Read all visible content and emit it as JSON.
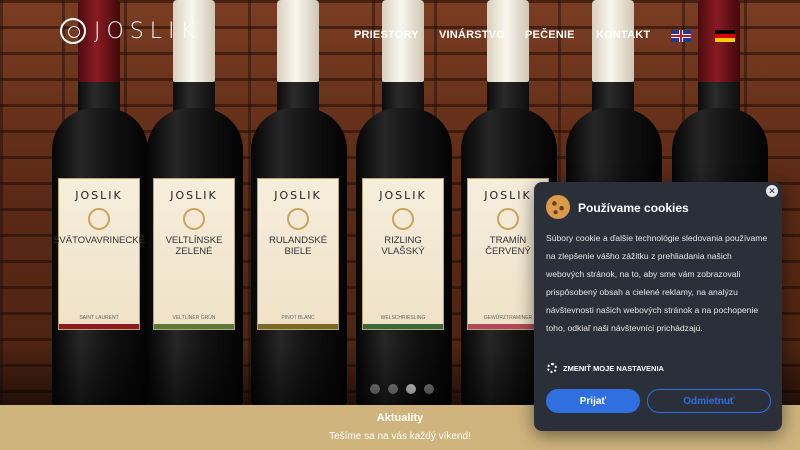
{
  "brand": {
    "name": "JOSLIK",
    "icon": "joslik-logo-icon"
  },
  "nav": {
    "items": [
      {
        "label": "PRIESTORY"
      },
      {
        "label": "VINÁRSTVO"
      },
      {
        "label": "PEČENIE"
      },
      {
        "label": "KONTAKT"
      }
    ],
    "languages": [
      {
        "name": "English",
        "icon": "uk-flag-icon"
      },
      {
        "name": "Deutsch",
        "icon": "de-flag-icon"
      }
    ]
  },
  "hero": {
    "bottles": [
      {
        "brand": "JOSLIK",
        "name": "SVÄTOVAVRINECKÉ",
        "sub": "SAINT LAURENT"
      },
      {
        "brand": "JOSLIK",
        "name": "VELTLÍNSKE ZELENÉ",
        "sub": "VELTLINER GRÜN"
      },
      {
        "brand": "JOSLIK",
        "name": "RULANDSKÉ BIELE",
        "sub": "PINOT BLANC"
      },
      {
        "brand": "JOSLIK",
        "name": "RIZLING VLAŠSKÝ",
        "sub": "WELSCHRIESLING"
      },
      {
        "brand": "JOSLIK",
        "name": "TRAMÍN ČERVENÝ",
        "sub": "GEWÜRZTRAMINER"
      }
    ],
    "carousel": {
      "slides": 4,
      "active": 3
    }
  },
  "news": {
    "title": "Aktuality",
    "text": "Tešíme sa na vás každý víkend!"
  },
  "cookie": {
    "title": "Používame cookies",
    "body": "Súbory cookie a ďalšie technológie sledovania používame na zlepšenie vášho zážitku z prehliadania našich webových stránok, na to, aby sme vám zobrazovali prispôsobený obsah a cielené reklamy, na analýzu návštevnosti našich webových stránok a na pochopenie toho, odkiaľ naši návštevníci prichádzajú.",
    "settings_label": "ZMENIŤ MOJE NASTAVENIA",
    "accept_label": "Prijať",
    "reject_label": "Odmietnuť",
    "colors": {
      "background": "#2b2f3a",
      "accent": "#2f6fdf"
    }
  },
  "colors": {
    "news_band": "#cfb47d"
  }
}
